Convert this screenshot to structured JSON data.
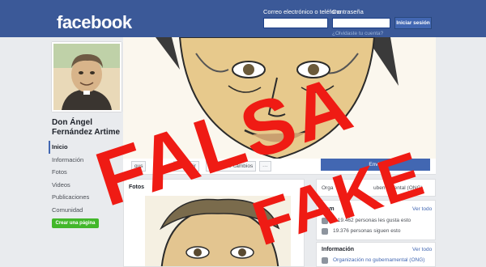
{
  "header": {
    "logo": "facebook",
    "email_label": "Correo electrónico o teléfono",
    "password_label": "Contraseña",
    "forgot_link": "¿Olvidaste tu cuenta?",
    "login_button": "Iniciar sesión"
  },
  "page": {
    "name": "Don Ángel Fernández Artime"
  },
  "sidebar": {
    "items": [
      {
        "label": "Inicio",
        "active": true
      },
      {
        "label": "Información"
      },
      {
        "label": "Fotos"
      },
      {
        "label": "Videos"
      },
      {
        "label": "Publicaciones"
      },
      {
        "label": "Comunidad"
      }
    ],
    "create_page": "Crear una página"
  },
  "actions": {
    "like_partial": "gus",
    "share_partial": "ompartir",
    "suggest": "Sugerir cambios",
    "more": "···",
    "send_partial": "Envia"
  },
  "photos": {
    "heading": "Fotos"
  },
  "right": {
    "category_partial": "Orga",
    "category_partial2": "ubernamental (ONG)",
    "community_partial": "Com",
    "see_all": "Ver todo",
    "likes": "A 19.462 personas les gusta esto",
    "follows": "19.376 personas siguen esto",
    "info_heading": "Información",
    "info_see_all": "Ver todo",
    "org_link": "Organización no gubernamental (ONG)"
  },
  "overlay": {
    "stamp1": "FALSA",
    "stamp2": "FAKE"
  },
  "colors": {
    "header_blue": "#3b5998",
    "stamp_red": "#ef1b14",
    "create_green": "#42b72a"
  }
}
